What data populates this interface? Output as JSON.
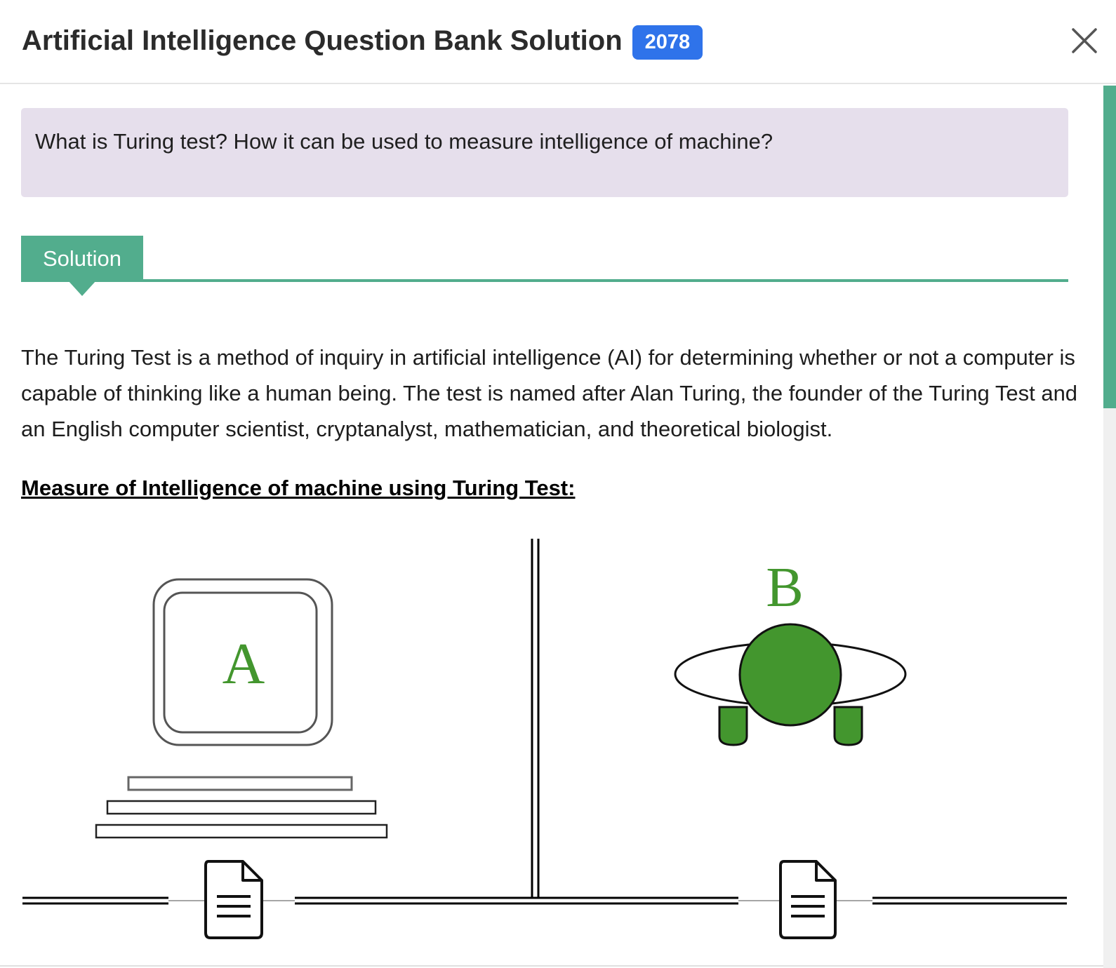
{
  "header": {
    "title": "Artificial Intelligence Question Bank Solution",
    "badge": "2078"
  },
  "question": {
    "text": "What is Turing test? How it can be used to measure intelligence of machine?"
  },
  "solution": {
    "tab_label": "Solution",
    "paragraph": "The Turing Test is a method of inquiry in artificial intelligence (AI) for determining whether or not a computer is capable of thinking like a human being. The test is named after Alan Turing, the founder of the Turing Test and an English computer scientist, cryptanalyst, mathematician, and theoretical biologist.",
    "subheading": "Measure of Intelligence of machine using Turing Test:"
  },
  "diagram": {
    "label_a": "A",
    "label_b": "B",
    "accent_color": "#43962e"
  },
  "colors": {
    "badge": "#2f73ea",
    "solution_accent": "#52ad8d",
    "question_bg": "#e6dfec"
  }
}
